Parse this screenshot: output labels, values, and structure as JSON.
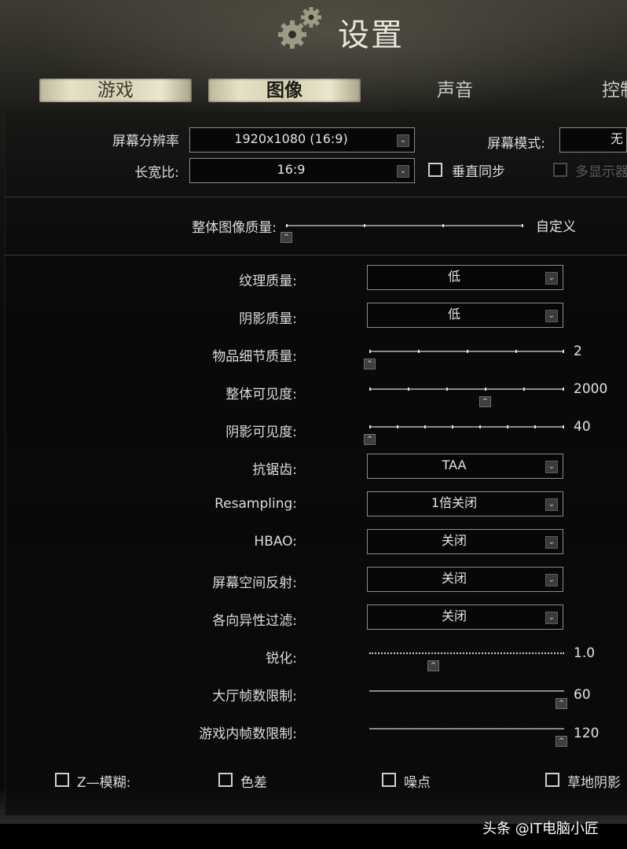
{
  "header": {
    "title": "设置",
    "icon": "gears-icon",
    "tabs": {
      "game": "游戏",
      "graphics": "图像",
      "sound": "声音",
      "controls": "控制"
    }
  },
  "display": {
    "resolution_label": "屏幕分辨率",
    "resolution_value": "1920x1080 (16:9)",
    "aspect_label": "长宽比:",
    "aspect_value": "16:9",
    "screen_mode_label": "屏幕模式:",
    "screen_mode_value": "无",
    "vsync_label": "垂直同步",
    "vsync_checked": false,
    "multi_monitor_label": "多显示器",
    "multi_monitor_checked": false
  },
  "overall_quality": {
    "label": "整体图像质量:",
    "value": "自定义",
    "level": 0
  },
  "settings": {
    "texture": {
      "label": "纹理质量:",
      "value": "低"
    },
    "shadow": {
      "label": "阴影质量:",
      "value": "低"
    },
    "object_lod": {
      "label": "物品细节质量:",
      "value": "2",
      "fraction": 0
    },
    "overall_visibility": {
      "label": "整体可见度:",
      "value": "2000",
      "fraction": 0.6
    },
    "shadow_visibility": {
      "label": "阴影可见度:",
      "value": "40",
      "fraction": 0
    },
    "antialiasing": {
      "label": "抗锯齿:",
      "value": "TAA"
    },
    "resampling": {
      "label": "Resampling:",
      "value": "1倍关闭"
    },
    "hbao": {
      "label": "HBAO:",
      "value": "关闭"
    },
    "ssr": {
      "label": "屏幕空间反射:",
      "value": "关闭"
    },
    "anisotropic": {
      "label": "各向异性过滤:",
      "value": "关闭"
    },
    "sharpen": {
      "label": "锐化:",
      "value": "1.0",
      "fraction": 0.33
    },
    "lobby_fps": {
      "label": "大厅帧数限制:",
      "value": "60",
      "fraction": 1
    },
    "game_fps": {
      "label": "游戏内帧数限制:",
      "value": "120",
      "fraction": 1
    }
  },
  "effects": {
    "z_blur": "Z—模糊:",
    "chromatic": "色差",
    "noise": "噪点",
    "grass_shadows": "草地阴影"
  },
  "watermark": "头条 @IT电脑小匠",
  "colors": {
    "tab_paper": "#e6e1c7",
    "panel_bg": "#0b0b0b",
    "text": "#dcdcdc"
  }
}
